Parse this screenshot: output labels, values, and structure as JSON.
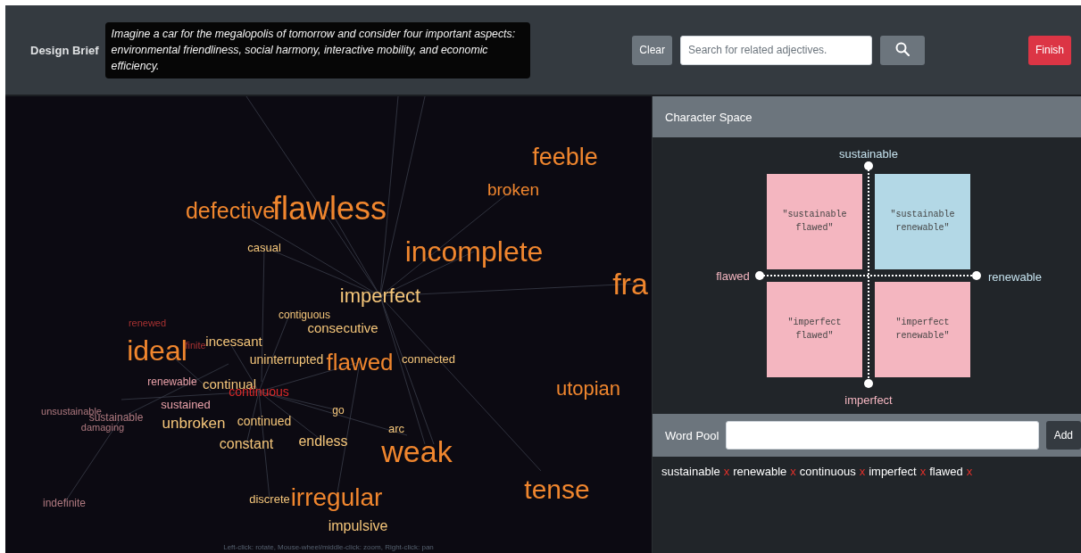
{
  "header": {
    "label": "Design Brief",
    "brief": "Imagine a car for the megalopolis of tomorrow and consider four important aspects: environmental friendliness, social harmony, interactive mobility, and economic efficiency.",
    "clear_button": "Clear",
    "search": {
      "placeholder": "Search for related adjectives."
    },
    "finish_button": "Finish"
  },
  "word_graph": {
    "words": [
      {
        "text": "feeble",
        "color": "#f0862e"
      },
      {
        "text": "broken",
        "color": "#f0862e"
      },
      {
        "text": "defective",
        "color": "#f0862e"
      },
      {
        "text": "flawless",
        "color": "#f0862e"
      },
      {
        "text": "casual",
        "color": "#f5c67a"
      },
      {
        "text": "incomplete",
        "color": "#f0862e"
      },
      {
        "text": "fra",
        "color": "#f0862e"
      },
      {
        "text": "imperfect",
        "color": "#f5c67a"
      },
      {
        "text": "contiguous",
        "color": "#f5c67a"
      },
      {
        "text": "renewed",
        "color": "#a83232"
      },
      {
        "text": "consecutive",
        "color": "#f5c67a"
      },
      {
        "text": "ideal",
        "color": "#f0862e"
      },
      {
        "text": "finite",
        "color": "#a83232"
      },
      {
        "text": "incessant",
        "color": "#f5c67a"
      },
      {
        "text": "uninterrupted",
        "color": "#f5c67a"
      },
      {
        "text": "flawed",
        "color": "#f0862e"
      },
      {
        "text": "connected",
        "color": "#f5c67a"
      },
      {
        "text": "renewable",
        "color": "#e8a0a8"
      },
      {
        "text": "continual",
        "color": "#f5c67a"
      },
      {
        "text": "continuous",
        "color": "#d92a2a"
      },
      {
        "text": "utopian",
        "color": "#f0862e"
      },
      {
        "text": "unsustainable",
        "color": "#b07a80"
      },
      {
        "text": "sustained",
        "color": "#e8a0a8"
      },
      {
        "text": "go",
        "color": "#f5c67a"
      },
      {
        "text": "sustainable",
        "color": "#b07a80"
      },
      {
        "text": "damaging",
        "color": "#b07a80"
      },
      {
        "text": "unbroken",
        "color": "#f5c67a"
      },
      {
        "text": "continued",
        "color": "#f5c67a"
      },
      {
        "text": "constant",
        "color": "#f5c67a"
      },
      {
        "text": "endless",
        "color": "#f5c67a"
      },
      {
        "text": "arc",
        "color": "#f5c67a"
      },
      {
        "text": "weak",
        "color": "#f0862e"
      },
      {
        "text": "indefinite",
        "color": "#b07a80"
      },
      {
        "text": "discrete",
        "color": "#f5c67a"
      },
      {
        "text": "irregular",
        "color": "#f0862e"
      },
      {
        "text": "tense",
        "color": "#f0862e"
      },
      {
        "text": "impulsive",
        "color": "#f5c67a"
      }
    ],
    "hint": "Left-click: rotate, Mouse-wheel/middle-click: zoom, Right-click: pan"
  },
  "character_space": {
    "title": "Character Space",
    "axes": [
      {
        "label": "sustainable",
        "color": "#c6e3ef"
      },
      {
        "label": "flawed",
        "color": "#f4b6c0"
      },
      {
        "label": "renewable",
        "color": "#c6e3ef"
      },
      {
        "label": "imperfect",
        "color": "#f4b6c0"
      }
    ],
    "quadrants": [
      {
        "label": "\"sustainable flawed\"",
        "color": "#f4b6c0"
      },
      {
        "label": "\"sustainable renewable\"",
        "color": "#b3d8e6"
      },
      {
        "label": "\"imperfect flawed\"",
        "color": "#f4b6c0"
      },
      {
        "label": "\"imperfect renewable\"",
        "color": "#f4b6c0"
      }
    ]
  },
  "word_pool": {
    "label": "Word Pool",
    "add_button": "Add",
    "words": [
      {
        "text": "sustainable",
        "remove": "x"
      },
      {
        "text": "renewable",
        "remove": "x"
      },
      {
        "text": "continuous",
        "remove": "x"
      },
      {
        "text": "imperfect",
        "remove": "x"
      },
      {
        "text": "flawed",
        "remove": "x"
      }
    ]
  }
}
